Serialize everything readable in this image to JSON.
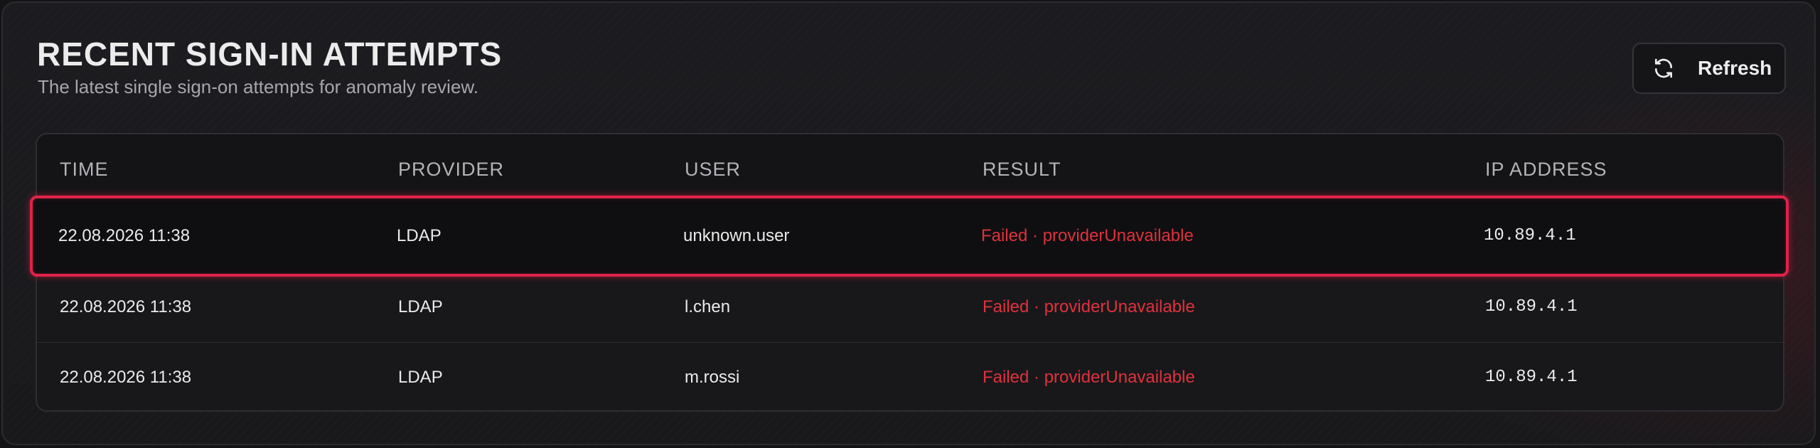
{
  "header": {
    "title": "RECENT SIGN-IN ATTEMPTS",
    "subtitle": "The latest single sign-on attempts for anomaly review.",
    "refresh_label": "Refresh",
    "refresh_icon": "refresh-icon"
  },
  "table": {
    "columns": [
      "TIME",
      "PROVIDER",
      "USER",
      "RESULT",
      "IP ADDRESS"
    ],
    "rows": [
      {
        "time": "22.08.2026 11:38",
        "provider": "LDAP",
        "user": "unknown.user",
        "result": "Failed · providerUnavailable",
        "ip": "10.89.4.1",
        "selected": true
      },
      {
        "time": "22.08.2026 11:38",
        "provider": "LDAP",
        "user": "l.chen",
        "result": "Failed · providerUnavailable",
        "ip": "10.89.4.1",
        "selected": false
      },
      {
        "time": "22.08.2026 11:38",
        "provider": "LDAP",
        "user": "m.rossi",
        "result": "Failed · providerUnavailable",
        "ip": "10.89.4.1",
        "selected": false
      }
    ]
  },
  "colors": {
    "accent_highlight": "#e0224a",
    "failed_text": "#e0313c",
    "background": "#1c1c20"
  }
}
